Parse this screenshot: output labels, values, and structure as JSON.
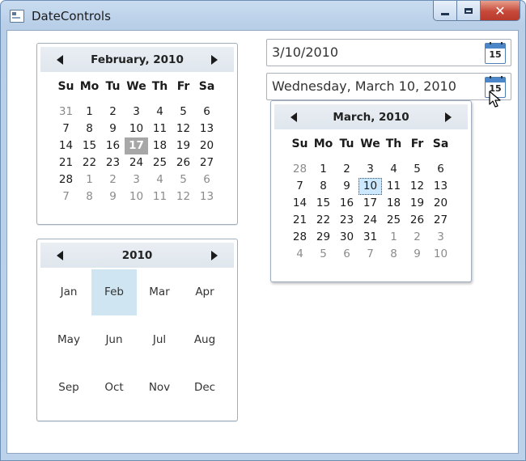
{
  "window": {
    "title": "DateControls",
    "close_glyph": "✕"
  },
  "calendar_month": {
    "title": "February, 2010",
    "dow": [
      "Su",
      "Mo",
      "Tu",
      "We",
      "Th",
      "Fr",
      "Sa"
    ],
    "weeks": [
      [
        "31",
        "1",
        "2",
        "3",
        "4",
        "5",
        "6"
      ],
      [
        "7",
        "8",
        "9",
        "10",
        "11",
        "12",
        "13"
      ],
      [
        "14",
        "15",
        "16",
        "17",
        "18",
        "19",
        "20"
      ],
      [
        "21",
        "22",
        "23",
        "24",
        "25",
        "26",
        "27"
      ],
      [
        "28",
        "1",
        "2",
        "3",
        "4",
        "5",
        "6"
      ],
      [
        "7",
        "8",
        "9",
        "10",
        "11",
        "12",
        "13"
      ]
    ],
    "today": "17"
  },
  "calendar_year": {
    "title": "2010",
    "months": [
      "Jan",
      "Feb",
      "Mar",
      "Apr",
      "May",
      "Jun",
      "Jul",
      "Aug",
      "Sep",
      "Oct",
      "Nov",
      "Dec"
    ],
    "selected": "Feb"
  },
  "datepicker_short": {
    "value": "3/10/2010",
    "icon_number": "15"
  },
  "datepicker_long": {
    "value": "Wednesday, March 10, 2010",
    "icon_number": "15"
  },
  "popup_calendar": {
    "title": "March, 2010",
    "dow": [
      "Su",
      "Mo",
      "Tu",
      "We",
      "Th",
      "Fr",
      "Sa"
    ],
    "weeks": [
      [
        "28",
        "1",
        "2",
        "3",
        "4",
        "5",
        "6"
      ],
      [
        "7",
        "8",
        "9",
        "10",
        "11",
        "12",
        "13"
      ],
      [
        "14",
        "15",
        "16",
        "17",
        "18",
        "19",
        "20"
      ],
      [
        "21",
        "22",
        "23",
        "24",
        "25",
        "26",
        "27"
      ],
      [
        "28",
        "29",
        "30",
        "31",
        "1",
        "2",
        "3"
      ],
      [
        "4",
        "5",
        "6",
        "7",
        "8",
        "9",
        "10"
      ]
    ],
    "selected": "10"
  }
}
